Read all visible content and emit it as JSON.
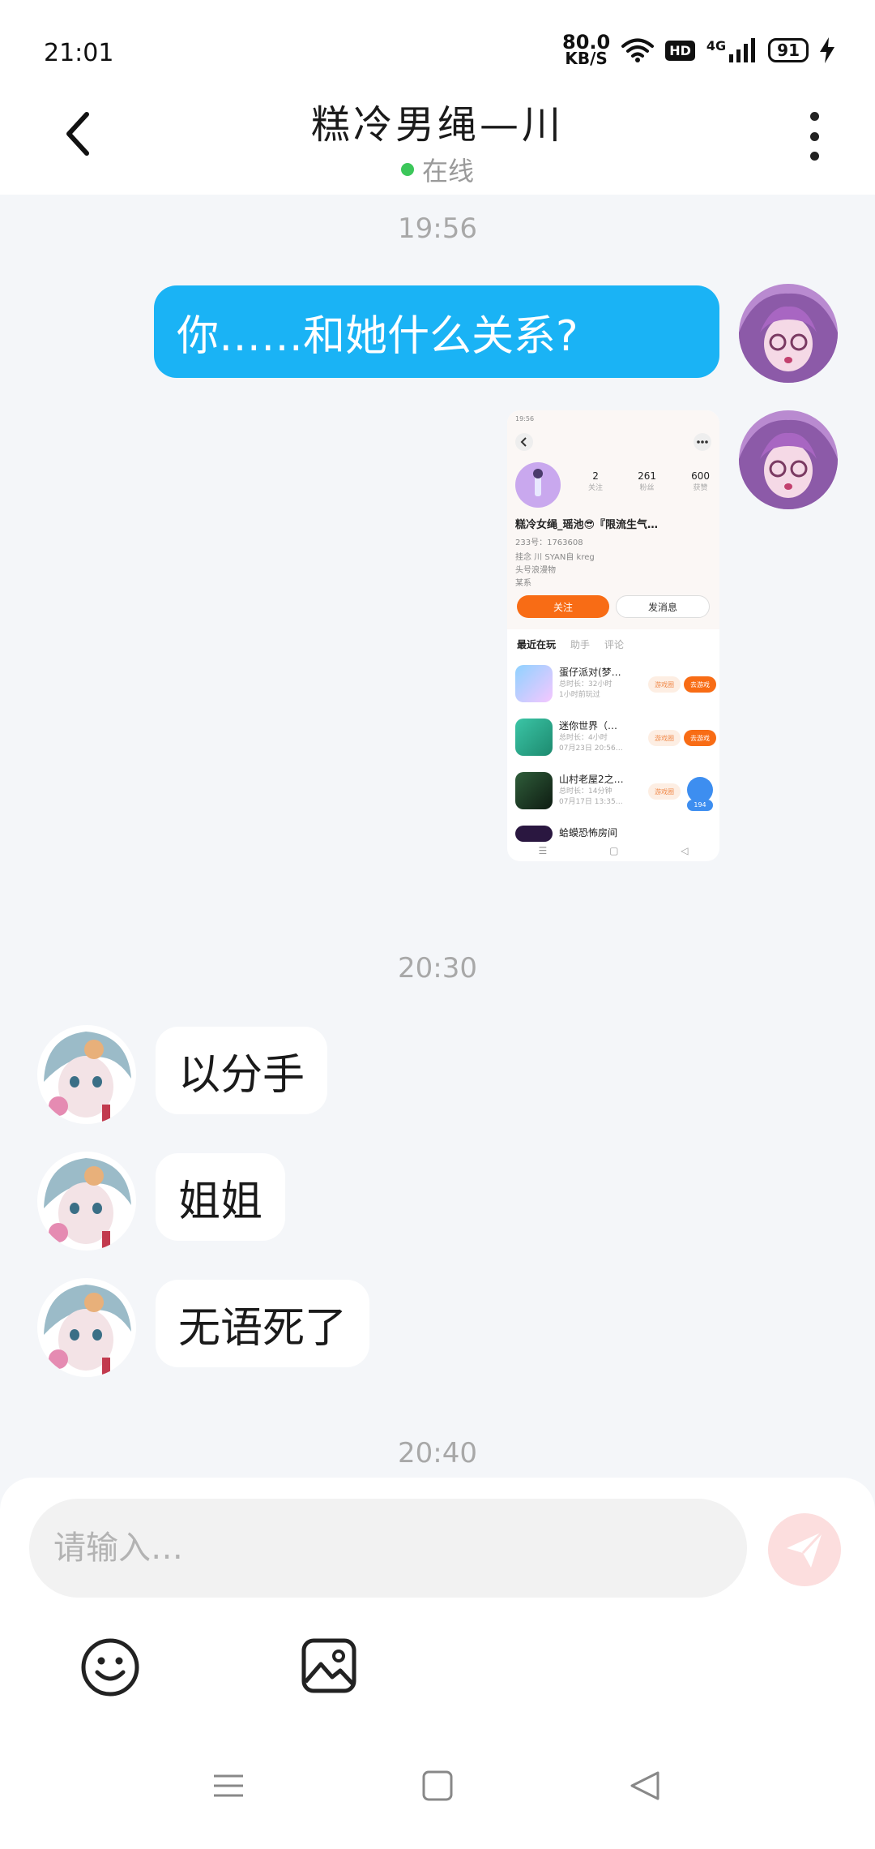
{
  "status_bar": {
    "time": "21:01",
    "net_speed_value": "80.0",
    "net_speed_unit": "KB/S",
    "hd_label": "HD",
    "network_label": "4G",
    "battery": "91",
    "icons": [
      "wifi-icon",
      "signal-icon",
      "charging-icon"
    ]
  },
  "header": {
    "title": "糕冷男绳—川",
    "status": "在线",
    "status_color": "#3cc75a",
    "icons": [
      "back-icon",
      "more-icon"
    ]
  },
  "messages": [
    {
      "type": "timestamp",
      "text": "19:56"
    },
    {
      "type": "text",
      "from": "me",
      "text": "你……和她什么关系?"
    },
    {
      "type": "image",
      "from": "me"
    },
    {
      "type": "timestamp",
      "text": "20:30"
    },
    {
      "type": "text",
      "from": "them",
      "text": "以分手"
    },
    {
      "type": "text",
      "from": "them",
      "text": "姐姐"
    },
    {
      "type": "text",
      "from": "them",
      "text": "无语死了"
    },
    {
      "type": "timestamp",
      "text": "20:40"
    }
  ],
  "shared_screenshot": {
    "status_time": "19:56",
    "stats": [
      {
        "value": "2",
        "label": "关注"
      },
      {
        "value": "261",
        "label": "粉丝"
      },
      {
        "value": "600",
        "label": "获赞"
      }
    ],
    "profile_name": "糕冷女绳_瑶池😎『限流生气…",
    "id_line": "233号：1763608",
    "bio_lines": [
      "挂念 川 SYAN自 kreg",
      "头号浪漫物",
      "某系"
    ],
    "follow_label": "关注",
    "message_label": "发消息",
    "tabs": [
      "最近在玩",
      "助手",
      "评论"
    ],
    "games": [
      {
        "name": "蛋仔派对(梦…",
        "sub1": "总时长：32小时",
        "sub2": "1小时前玩过",
        "btn1": "游戏圈",
        "btn2": "去游戏"
      },
      {
        "name": "迷你世界（…",
        "sub1": "总时长：4小时",
        "sub2": "07月23日 20:56…",
        "btn1": "游戏圈",
        "btn2": "去游戏"
      },
      {
        "name": "山村老屋2之…",
        "sub1": "总时长：14分钟",
        "sub2": "07月17日 13:35…",
        "btn1": "游戏圈",
        "btn2": ""
      },
      {
        "name": "蛤蟆恐怖房间",
        "sub1": "",
        "sub2": "",
        "btn1": "",
        "btn2": ""
      }
    ],
    "badge_count": "194"
  },
  "composer": {
    "placeholder": "请输入…",
    "icons": [
      "send-icon",
      "emoji-icon",
      "image-icon"
    ]
  },
  "nav_bar": {
    "icons": [
      "menu-icon",
      "home-icon",
      "back-triangle-icon"
    ]
  },
  "colors": {
    "my_bubble": "#1ab3f5",
    "their_bubble": "#ffffff",
    "background": "#f4f6f9",
    "accent_orange": "#f86c15"
  }
}
